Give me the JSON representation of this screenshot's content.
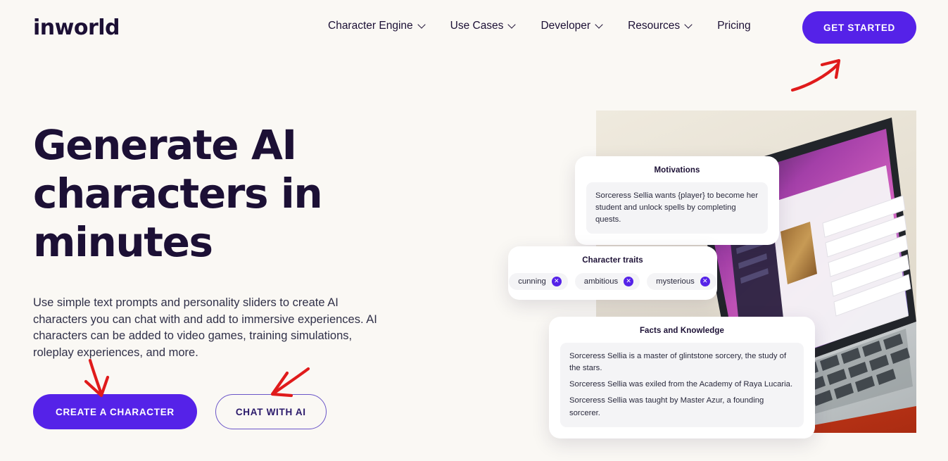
{
  "brand": {
    "logo_text": "inworld"
  },
  "nav": {
    "items": [
      {
        "label": "Character Engine",
        "has_dropdown": true
      },
      {
        "label": "Use Cases",
        "has_dropdown": true
      },
      {
        "label": "Developer",
        "has_dropdown": true
      },
      {
        "label": "Resources",
        "has_dropdown": true
      },
      {
        "label": "Pricing",
        "has_dropdown": false
      }
    ],
    "cta_label": "GET STARTED"
  },
  "hero": {
    "headline": "Generate AI characters in minutes",
    "subtext": "Use simple text prompts and personality sliders to create AI characters you can chat with and add to immersive experiences. AI characters can be added to video games, training simulations, roleplay experiences, and more.",
    "primary_button": "CREATE A CHARACTER",
    "secondary_button": "CHAT WITH AI"
  },
  "cards": {
    "motivations": {
      "title": "Motivations",
      "body": "Sorceress Sellia wants {player} to become her student and unlock spells by completing quests."
    },
    "traits": {
      "title": "Character traits",
      "chips": [
        "cunning",
        "ambitious",
        "mysterious"
      ],
      "remove_glyph": "✕"
    },
    "facts": {
      "title": "Facts and Knowledge",
      "lines": [
        "Sorceress Sellia is a master of glintstone sorcery, the study of the stars.",
        "Sorceress Sellia was exiled from the Academy of Raya Lucaria.",
        "Sorceress Sellia was taught by Master Azur, a founding sorcerer."
      ]
    }
  },
  "colors": {
    "background": "#faf8f4",
    "accent_purple": "#5522e8",
    "text_dark": "#1c1035",
    "annotation_red": "#e01b1b"
  },
  "annotations": {
    "arrow_get_started": "arrow pointing up-right to GET STARTED",
    "arrow_create_character": "arrow pointing down to CREATE A CHARACTER",
    "arrow_chat_with_ai": "arrow pointing down-left to CHAT WITH AI"
  }
}
